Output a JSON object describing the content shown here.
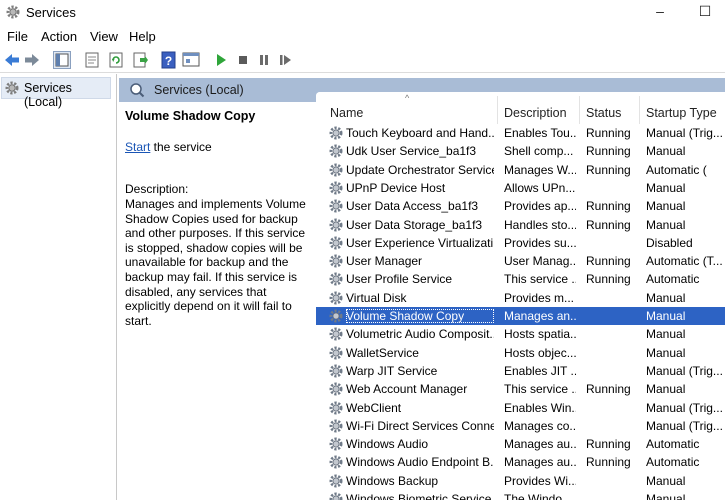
{
  "window": {
    "title": "Services"
  },
  "menu": [
    "File",
    "Action",
    "View",
    "Help"
  ],
  "tree": {
    "root_label": "Services (Local)"
  },
  "panel": {
    "header_label": "Services (Local)"
  },
  "details": {
    "service_name": "Volume Shadow Copy",
    "start_link": "Start",
    "start_suffix": " the service",
    "description_label": "Description:",
    "description": "Manages and implements Volume Shadow Copies used for backup and other purposes. If this service is stopped, shadow copies will be unavailable for backup and the backup may fail. If this service is disabled, any services that explicitly depend on it will fail to start."
  },
  "columns": [
    "Name",
    "Description",
    "Status",
    "Startup Type"
  ],
  "services": [
    {
      "name": "Touch Keyboard and Hand...",
      "description": "Enables Tou...",
      "status": "Running",
      "startup": "Manual (Trig..."
    },
    {
      "name": "Udk User Service_ba1f3",
      "description": "Shell comp...",
      "status": "Running",
      "startup": "Manual"
    },
    {
      "name": "Update Orchestrator Service",
      "description": "Manages W...",
      "status": "Running",
      "startup": "Automatic ("
    },
    {
      "name": "UPnP Device Host",
      "description": "Allows UPn...",
      "status": "",
      "startup": "Manual"
    },
    {
      "name": "User Data Access_ba1f3",
      "description": "Provides ap...",
      "status": "Running",
      "startup": "Manual"
    },
    {
      "name": "User Data Storage_ba1f3",
      "description": "Handles sto...",
      "status": "Running",
      "startup": "Manual"
    },
    {
      "name": "User Experience Virtualizati...",
      "description": "Provides su...",
      "status": "",
      "startup": "Disabled"
    },
    {
      "name": "User Manager",
      "description": "User Manag...",
      "status": "Running",
      "startup": "Automatic (T..."
    },
    {
      "name": "User Profile Service",
      "description": "This service ...",
      "status": "Running",
      "startup": "Automatic"
    },
    {
      "name": "Virtual Disk",
      "description": "Provides m...",
      "status": "",
      "startup": "Manual"
    },
    {
      "name": "Volume Shadow Copy",
      "description": "Manages an...",
      "status": "",
      "startup": "Manual",
      "selected": true
    },
    {
      "name": "Volumetric Audio Composit...",
      "description": "Hosts spatia...",
      "status": "",
      "startup": "Manual"
    },
    {
      "name": "WalletService",
      "description": "Hosts objec...",
      "status": "",
      "startup": "Manual"
    },
    {
      "name": "Warp JIT Service",
      "description": "Enables JIT ...",
      "status": "",
      "startup": "Manual (Trig..."
    },
    {
      "name": "Web Account Manager",
      "description": "This service ...",
      "status": "Running",
      "startup": "Manual"
    },
    {
      "name": "WebClient",
      "description": "Enables Win...",
      "status": "",
      "startup": "Manual (Trig..."
    },
    {
      "name": "Wi-Fi Direct Services Conne...",
      "description": "Manages co...",
      "status": "",
      "startup": "Manual (Trig..."
    },
    {
      "name": "Windows Audio",
      "description": "Manages au...",
      "status": "Running",
      "startup": "Automatic"
    },
    {
      "name": "Windows Audio Endpoint B...",
      "description": "Manages au...",
      "status": "Running",
      "startup": "Automatic"
    },
    {
      "name": "Windows Backup",
      "description": "Provides Wi...",
      "status": "",
      "startup": "Manual"
    },
    {
      "name": "Windows Biometric Service",
      "description": "The Windo...",
      "status": "",
      "startup": "Manual"
    }
  ],
  "colors": {
    "selection": "#2d63c4",
    "panel_header": "#a9bcd6",
    "link": "#1a55b5"
  },
  "icons": {
    "app": "gear-icon",
    "service": "gear-icon",
    "toolbar": [
      "back-arrow-icon",
      "forward-arrow-icon",
      "show-tree-icon",
      "properties-icon",
      "refresh-icon",
      "export-icon",
      "help-icon",
      "console-icon",
      "play-icon",
      "stop-icon",
      "pause-icon",
      "restart-icon"
    ]
  }
}
